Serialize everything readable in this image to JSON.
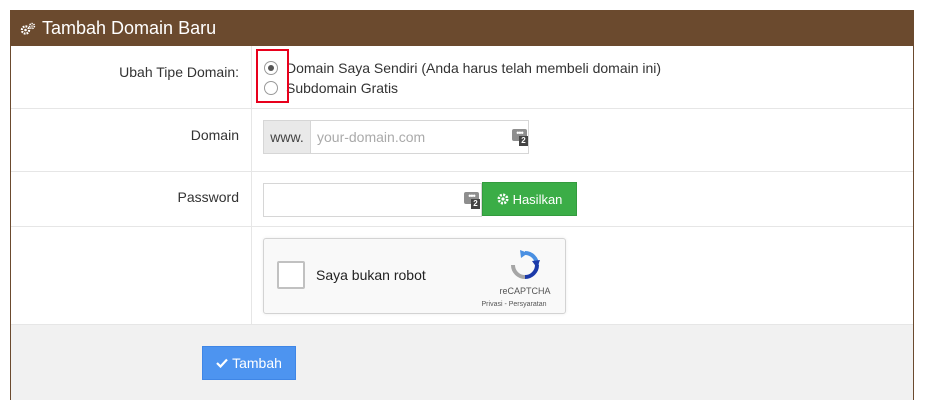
{
  "panel": {
    "title": "Tambah Domain Baru",
    "title_icon": "cogs-icon",
    "header_color": "#6b4a2e"
  },
  "domain_type": {
    "label": "Ubah Tipe Domain:",
    "options": [
      {
        "label": "Domain Saya Sendiri (Anda harus telah membeli domain ini)",
        "selected": true
      },
      {
        "label": "Subdomain Gratis",
        "selected": false
      }
    ]
  },
  "domain": {
    "label": "Domain",
    "prefix": "www.",
    "placeholder": "your-domain.com",
    "value": "",
    "password_manager_badge": "2"
  },
  "password": {
    "label": "Password",
    "value": "",
    "password_manager_badge": "2",
    "generate_button": "Hasilkan",
    "generate_icon": "cog-icon",
    "generate_color": "#3bad47"
  },
  "captcha": {
    "label": "Saya bukan robot",
    "brand": "reCAPTCHA",
    "links": "Privasi - Persyaratan",
    "checked": false
  },
  "submit": {
    "label": "Tambah",
    "icon": "check-icon",
    "color": "#4d94f0"
  },
  "highlight_color": "#e8001c"
}
